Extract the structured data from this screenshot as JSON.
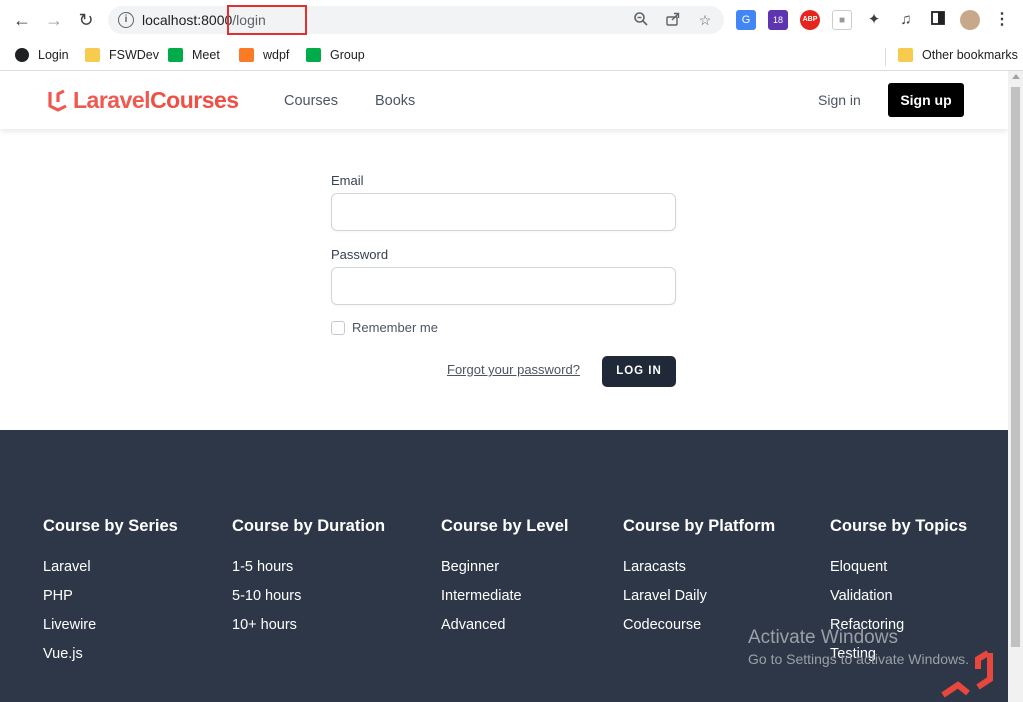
{
  "browser": {
    "url_host": "localhost:8000",
    "url_path": "/login",
    "bookmarks": [
      {
        "label": "Login",
        "icon": "globe-icon"
      },
      {
        "label": "FSWDev",
        "icon": "folder-icon"
      },
      {
        "label": "Meet",
        "icon": "meet-icon"
      },
      {
        "label": "wdpf",
        "icon": "xampp-icon"
      },
      {
        "label": "Group",
        "icon": "meet-icon"
      }
    ],
    "other_bookmarks": "Other bookmarks",
    "extension_badge": "18",
    "abp_label": "ABP"
  },
  "header": {
    "logo_part1": "Laravel",
    "logo_part2": "Courses",
    "nav": [
      "Courses",
      "Books"
    ],
    "signin": "Sign in",
    "signup": "Sign up"
  },
  "login_form": {
    "email_label": "Email",
    "email_value": "",
    "password_label": "Password",
    "password_value": "",
    "remember_label": "Remember me",
    "remember_checked": false,
    "forgot_link": "Forgot your password?",
    "submit": "LOG IN"
  },
  "footer": {
    "columns": [
      {
        "title": "Course by Series",
        "items": [
          "Laravel",
          "PHP",
          "Livewire",
          "Vue.js"
        ]
      },
      {
        "title": "Course by Duration",
        "items": [
          "1-5 hours",
          "5-10 hours",
          "10+ hours"
        ]
      },
      {
        "title": "Course by Level",
        "items": [
          "Beginner",
          "Intermediate",
          "Advanced"
        ]
      },
      {
        "title": "Course by Platform",
        "items": [
          "Laracasts",
          "Laravel Daily",
          "Codecourse"
        ]
      },
      {
        "title": "Course by Topics",
        "items": [
          "Eloquent",
          "Validation",
          "Refactoring",
          "Testing"
        ]
      }
    ]
  },
  "watermark": {
    "line1": "Activate Windows",
    "line2": "Go to Settings to activate Windows."
  },
  "colors": {
    "brand": "#ef5950",
    "footer_bg": "#2d3748",
    "button_dark": "#1f2937"
  }
}
